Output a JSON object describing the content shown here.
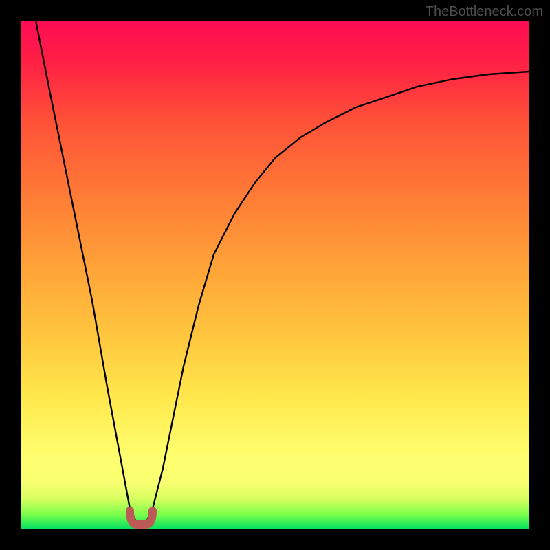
{
  "watermark": "TheBottleneck.com",
  "chart_data": {
    "type": "line",
    "title": "",
    "xlabel": "",
    "ylabel": "",
    "xlim": [
      0,
      100
    ],
    "ylim": [
      0,
      100
    ],
    "grid": false,
    "series": [
      {
        "name": "bottleneck-curve",
        "x": [
          3,
          6,
          10,
          14,
          17,
          20,
          21.5,
          23,
          24.5,
          26,
          28,
          30,
          32,
          35,
          38,
          42,
          46,
          50,
          55,
          60,
          66,
          72,
          78,
          85,
          92,
          100
        ],
        "y": [
          100,
          85,
          65,
          45,
          28,
          12,
          4,
          1,
          1,
          4,
          12,
          22,
          32,
          44,
          54,
          62,
          68,
          73,
          77,
          80,
          83,
          85,
          87,
          88.5,
          89.5,
          90
        ]
      }
    ],
    "marker": {
      "name": "optimal-region",
      "x_range": [
        21.5,
        24.5
      ],
      "y": 1,
      "color": "#bc5a57"
    },
    "background_gradient": {
      "bottom_color": "#00e060",
      "top_color": "#ff0c54",
      "stops": [
        "green",
        "yellow",
        "orange",
        "red"
      ]
    }
  }
}
